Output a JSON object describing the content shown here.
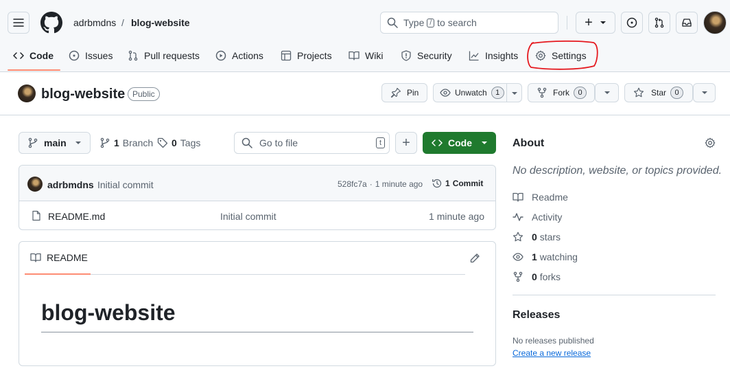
{
  "header": {
    "owner": "adrbmdns",
    "separator": "/",
    "repo": "blog-website",
    "search_prefix": "Type",
    "search_key": "/",
    "search_suffix": "to search",
    "plus_label": "+"
  },
  "nav": {
    "tabs": [
      {
        "label": "Code"
      },
      {
        "label": "Issues"
      },
      {
        "label": "Pull requests"
      },
      {
        "label": "Actions"
      },
      {
        "label": "Projects"
      },
      {
        "label": "Wiki"
      },
      {
        "label": "Security"
      },
      {
        "label": "Insights"
      },
      {
        "label": "Settings"
      }
    ],
    "highlight_color": "#e5181e"
  },
  "repo_header": {
    "name": "blog-website",
    "visibility": "Public",
    "pin_label": "Pin",
    "watch_label": "Unwatch",
    "watch_count": "1",
    "fork_label": "Fork",
    "fork_count": "0",
    "star_label": "Star",
    "star_count": "0"
  },
  "toolbar": {
    "branch": "main",
    "branches_count": "1",
    "branches_label": "Branch",
    "tags_count": "0",
    "tags_label": "Tags",
    "go_to_file_placeholder": "Go to file",
    "go_to_file_key": "t",
    "add_label": "+",
    "code_label": "Code",
    "code_button_color": "#1f7a2e"
  },
  "commit": {
    "author": "adrbmdns",
    "message": "Initial commit",
    "hash": "528fc7a",
    "separator": "·",
    "time": "1 minute ago",
    "commits_count": "1",
    "commits_label": "Commit"
  },
  "files": [
    {
      "name": "README.md",
      "message": "Initial commit",
      "time": "1 minute ago"
    }
  ],
  "readme": {
    "tab_label": "README",
    "heading": "blog-website"
  },
  "about": {
    "title": "About",
    "description": "No description, website, or topics provided.",
    "readme_label": "Readme",
    "activity_label": "Activity",
    "stars_count": "0",
    "stars_label": "stars",
    "watching_count": "1",
    "watching_label": "watching",
    "forks_count": "0",
    "forks_label": "forks"
  },
  "releases": {
    "title": "Releases",
    "empty_text": "No releases published",
    "create_link": "Create a new release"
  },
  "colors": {
    "accent_blue": "#0969da",
    "nav_underline": "#fd8c73",
    "annotation_red": "#e5181e"
  }
}
